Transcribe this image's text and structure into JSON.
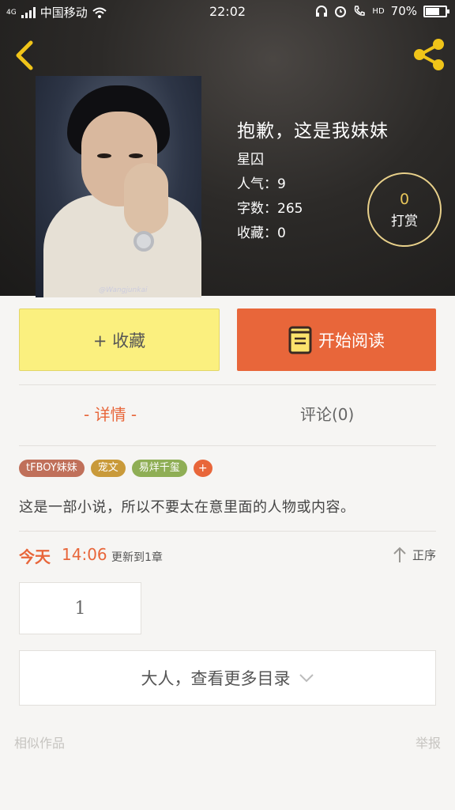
{
  "status_bar": {
    "network": "4G",
    "carrier": "中国移动",
    "time": "22:02",
    "hd": "HD",
    "battery": "70%",
    "battery_level": 0.7
  },
  "book": {
    "title": "抱歉，这是我妹妹",
    "author": "星囚",
    "popularity_label": "人气：",
    "popularity": "9",
    "word_count_label": "字数：",
    "word_count": "265",
    "favorites_label": "收藏：",
    "favorites": "0",
    "cover_credit": "@Wangjunkai"
  },
  "tip": {
    "count": "0",
    "label": "打赏"
  },
  "actions": {
    "collect_label": "+ 收藏",
    "read_label": "开始阅读"
  },
  "tabs": {
    "detail": "-  详情  -",
    "comments": "评论(0)"
  },
  "tags": [
    {
      "label": "tFBOY妹妹",
      "color": "#c0705a"
    },
    {
      "label": "宠文",
      "color": "#c99a3a"
    },
    {
      "label": "易烊千玺",
      "color": "#8fae55"
    }
  ],
  "tag_add": "+",
  "synopsis": "这是一部小说，所以不要太在意里面的人物或内容。",
  "update": {
    "day": "今天",
    "time": "14:06",
    "text": "更新到1章",
    "sort_label": "正序"
  },
  "chapters": [
    "1"
  ],
  "more_catalog": "大人，查看更多目录",
  "footer": {
    "similar": "相似作品",
    "report": "举报"
  },
  "colors": {
    "accent": "#e8663a",
    "collect_bg": "#fbf07f",
    "back_icon": "#f0c419",
    "share_icon": "#f0c419"
  }
}
